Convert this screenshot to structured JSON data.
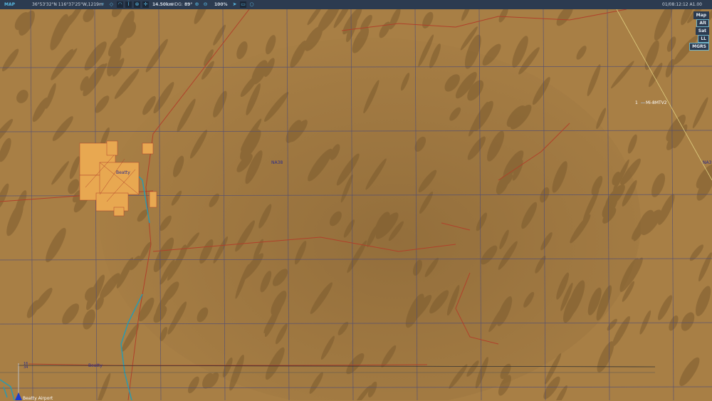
{
  "topbar": {
    "title": "MAP",
    "coords": "36°53'32\"N 116°37'25\"W,1219m",
    "scale": "14.50km",
    "hdg_label": "HDG:",
    "hdg_value": "89°",
    "zoom": "100%",
    "time": "01/08:12:12 A1.00",
    "icons": [
      "network-icon",
      "target-icon",
      "wifi-icon",
      "unit-icon",
      "compass-icon",
      "crosshair-icon",
      "zoom-in-icon",
      "zoom-out-icon",
      "nav-arrow-icon",
      "rectangle-icon",
      "circle-icon"
    ]
  },
  "layers": [
    {
      "label": "Map",
      "active": false
    },
    {
      "label": "Alt",
      "active": true
    },
    {
      "label": "Sat",
      "active": false
    },
    {
      "label": "LL",
      "active": true
    },
    {
      "label": "MGRS",
      "active": true
    }
  ],
  "labels": {
    "town": "Beatty",
    "na_center": "NA38",
    "na_edge": "NA3",
    "unit_num": "1",
    "unit_name": "Mi-8MTV2",
    "road": "Beatty",
    "runway": "16\n34",
    "airport": "Beatty Airport"
  },
  "colors": {
    "terrain": "#a87f45",
    "grid": "#4a4a7a",
    "road": "#b0402a",
    "water": "#2a9ab0",
    "town": "#e8a851",
    "topbar": "#2c3b50"
  }
}
